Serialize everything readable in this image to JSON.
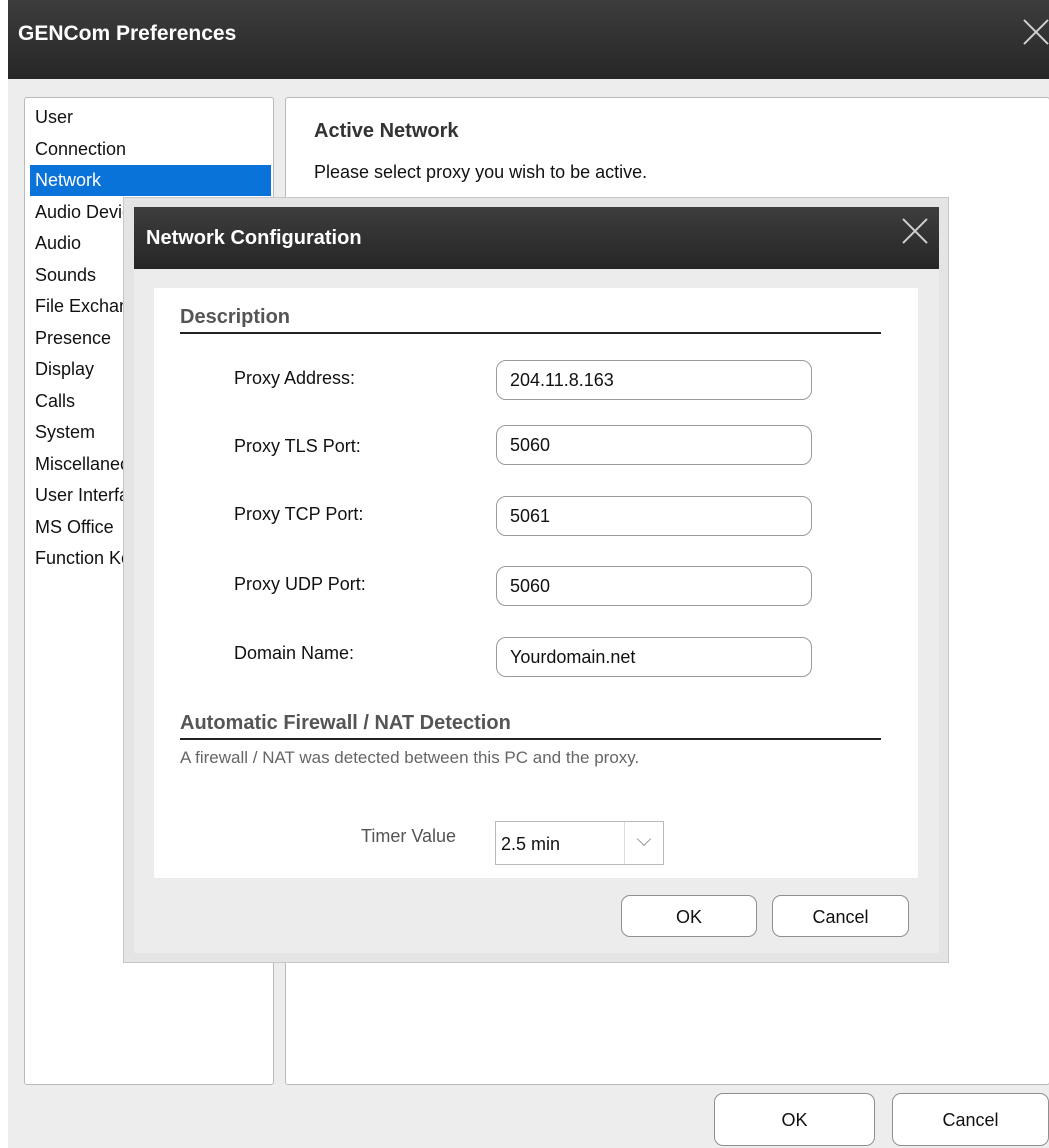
{
  "window": {
    "title": "GENCom Preferences"
  },
  "sidebar": {
    "items": [
      {
        "label": "User"
      },
      {
        "label": "Connection"
      },
      {
        "label": "Network",
        "selected": true
      },
      {
        "label": "Audio Devices"
      },
      {
        "label": "Audio"
      },
      {
        "label": "Sounds"
      },
      {
        "label": "File Exchange"
      },
      {
        "label": "Presence"
      },
      {
        "label": "Display"
      },
      {
        "label": "Calls"
      },
      {
        "label": "System"
      },
      {
        "label": "Miscellaneous"
      },
      {
        "label": "User Interface"
      },
      {
        "label": "MS Office"
      },
      {
        "label": "Function Keys"
      }
    ]
  },
  "content": {
    "heading": "Active Network",
    "description": "Please select proxy you wish to be active."
  },
  "footer": {
    "ok_label": "OK",
    "cancel_label": "Cancel"
  },
  "modal": {
    "title": "Network Configuration",
    "description_section": {
      "title": "Description",
      "fields": [
        {
          "label": "Proxy Address:",
          "value": "204.11.8.163"
        },
        {
          "label": "Proxy TLS Port:",
          "value": "5060"
        },
        {
          "label": "Proxy TCP Port:",
          "value": "5061"
        },
        {
          "label": "Proxy UDP Port:",
          "value": "5060"
        },
        {
          "label": "Domain Name:",
          "value": "Yourdomain.net"
        }
      ]
    },
    "nat_section": {
      "title": "Automatic Firewall / NAT Detection",
      "message": "A firewall / NAT was detected between this PC and the proxy.",
      "timer_label": "Timer Value",
      "timer_value": "2.5 min"
    },
    "ok_label": "OK",
    "cancel_label": "Cancel"
  },
  "icons": {
    "window_close": "close-icon",
    "modal_close": "close-icon",
    "timer_dropdown": "chevron-down-icon"
  },
  "colors": {
    "titlebar": "#2e2e2e",
    "selection": "#0a73d9"
  }
}
